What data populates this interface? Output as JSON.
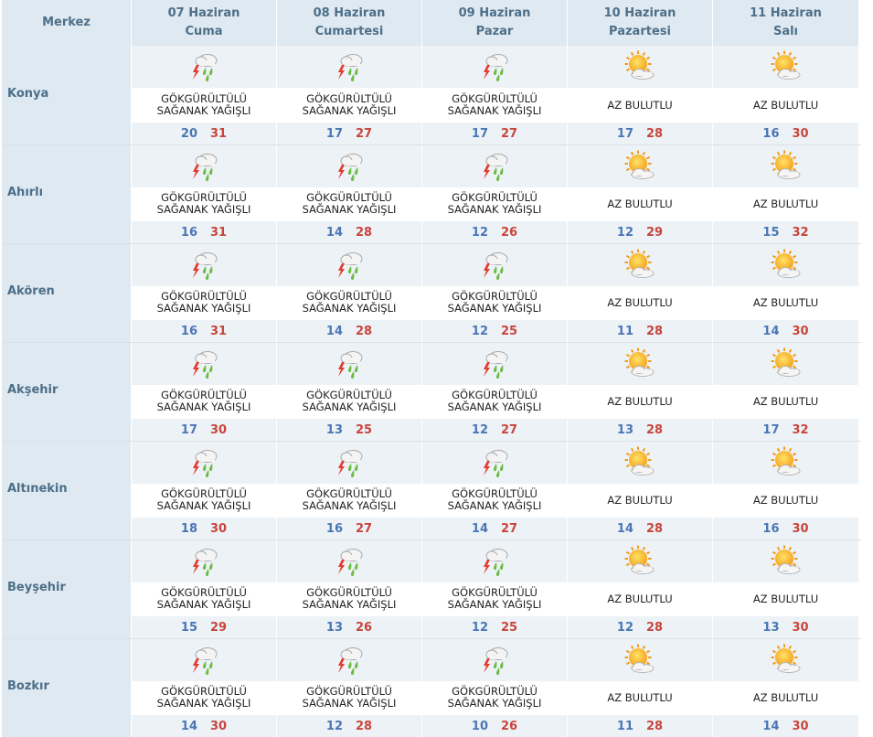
{
  "header": {
    "merkez": "Merkez",
    "days": [
      {
        "date": "07 Haziran",
        "weekday": "Cuma"
      },
      {
        "date": "08 Haziran",
        "weekday": "Cumartesi"
      },
      {
        "date": "09 Haziran",
        "weekday": "Pazar"
      },
      {
        "date": "10 Haziran",
        "weekday": "Pazartesi"
      },
      {
        "date": "11 Haziran",
        "weekday": "Salı"
      }
    ]
  },
  "conditions": {
    "storm": {
      "line1": "GÖKGÜRÜLTÜLÜ",
      "line2": "SAĞANAK YAĞIŞLI",
      "icon": "thunderstorm-rain-icon"
    },
    "sunny": {
      "line1": "AZ BULUTLU",
      "line2": "",
      "icon": "partly-cloudy-sun-icon"
    }
  },
  "rows": [
    {
      "city": "Konya",
      "days": [
        {
          "cond": "storm",
          "min": "20",
          "max": "31"
        },
        {
          "cond": "storm",
          "min": "17",
          "max": "27"
        },
        {
          "cond": "storm",
          "min": "17",
          "max": "27"
        },
        {
          "cond": "sunny",
          "min": "17",
          "max": "28"
        },
        {
          "cond": "sunny",
          "min": "16",
          "max": "30"
        }
      ]
    },
    {
      "city": "Ahırlı",
      "days": [
        {
          "cond": "storm",
          "min": "16",
          "max": "31"
        },
        {
          "cond": "storm",
          "min": "14",
          "max": "28"
        },
        {
          "cond": "storm",
          "min": "12",
          "max": "26"
        },
        {
          "cond": "sunny",
          "min": "12",
          "max": "29"
        },
        {
          "cond": "sunny",
          "min": "15",
          "max": "32"
        }
      ]
    },
    {
      "city": "Akören",
      "days": [
        {
          "cond": "storm",
          "min": "16",
          "max": "31"
        },
        {
          "cond": "storm",
          "min": "14",
          "max": "28"
        },
        {
          "cond": "storm",
          "min": "12",
          "max": "25"
        },
        {
          "cond": "sunny",
          "min": "11",
          "max": "28"
        },
        {
          "cond": "sunny",
          "min": "14",
          "max": "30"
        }
      ]
    },
    {
      "city": "Akşehir",
      "days": [
        {
          "cond": "storm",
          "min": "17",
          "max": "30"
        },
        {
          "cond": "storm",
          "min": "13",
          "max": "25"
        },
        {
          "cond": "storm",
          "min": "12",
          "max": "27"
        },
        {
          "cond": "sunny",
          "min": "13",
          "max": "28"
        },
        {
          "cond": "sunny",
          "min": "17",
          "max": "32"
        }
      ]
    },
    {
      "city": "Altınekin",
      "days": [
        {
          "cond": "storm",
          "min": "18",
          "max": "30"
        },
        {
          "cond": "storm",
          "min": "16",
          "max": "27"
        },
        {
          "cond": "storm",
          "min": "14",
          "max": "27"
        },
        {
          "cond": "sunny",
          "min": "14",
          "max": "28"
        },
        {
          "cond": "sunny",
          "min": "16",
          "max": "30"
        }
      ]
    },
    {
      "city": "Beyşehir",
      "days": [
        {
          "cond": "storm",
          "min": "15",
          "max": "29"
        },
        {
          "cond": "storm",
          "min": "13",
          "max": "26"
        },
        {
          "cond": "storm",
          "min": "12",
          "max": "25"
        },
        {
          "cond": "sunny",
          "min": "12",
          "max": "28"
        },
        {
          "cond": "sunny",
          "min": "13",
          "max": "30"
        }
      ]
    },
    {
      "city": "Bozkır",
      "days": [
        {
          "cond": "storm",
          "min": "14",
          "max": "30"
        },
        {
          "cond": "storm",
          "min": "12",
          "max": "28"
        },
        {
          "cond": "storm",
          "min": "10",
          "max": "26"
        },
        {
          "cond": "sunny",
          "min": "11",
          "max": "28"
        },
        {
          "cond": "sunny",
          "min": "14",
          "max": "30"
        }
      ]
    }
  ]
}
